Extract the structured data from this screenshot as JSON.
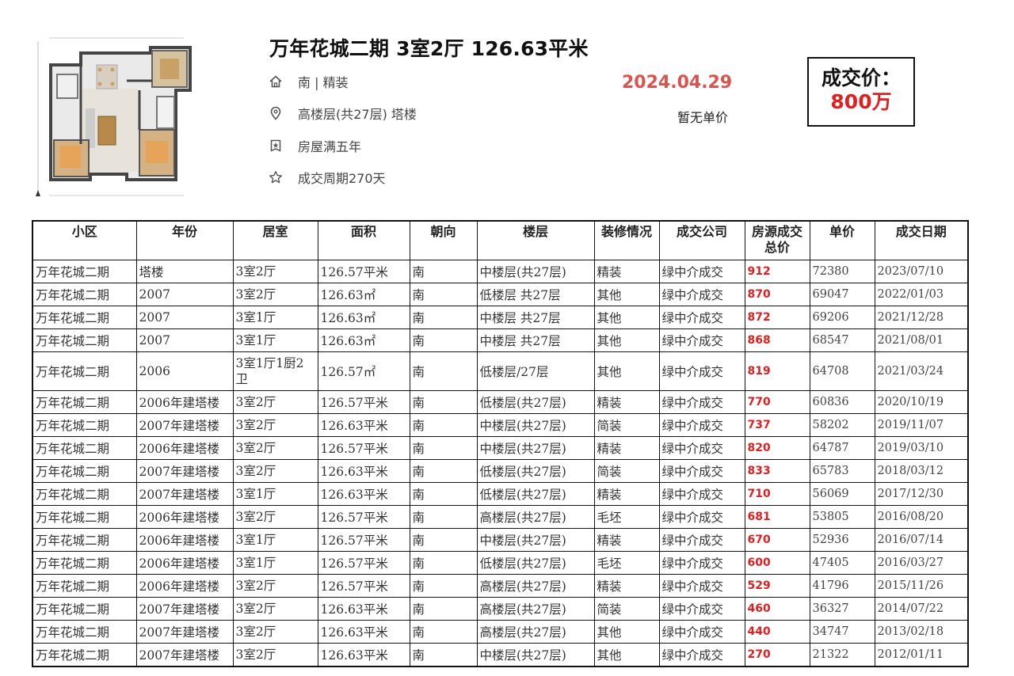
{
  "listing": {
    "title": "万年花城二期 3室2厅 126.63平米",
    "features": [
      {
        "icon": "home-icon",
        "text": "南 | 精装"
      },
      {
        "icon": "location-pin-icon",
        "text": "高楼层(共27层) 塔楼"
      },
      {
        "icon": "badge-icon",
        "text": "房屋满五年"
      },
      {
        "icon": "star-icon",
        "text": "成交周期270天"
      }
    ],
    "deal_date": "2024.04.29",
    "unit_price_note": "暂无单价",
    "deal_price_label": "成交价：",
    "deal_price_value": "800万"
  },
  "colors": {
    "accent_red": "#e02020",
    "date_red": "#d9534f"
  },
  "table": {
    "headers": [
      "小区",
      "年份",
      "居室",
      "面积",
      "朝向",
      "楼层",
      "装修情况",
      "成交公司",
      "房源成交总价",
      "单价",
      "成交日期"
    ],
    "rows": [
      [
        "万年花城二期",
        "塔楼",
        "3室2厅",
        "126.57平米",
        "南",
        "中楼层(共27层)",
        "精装",
        "绿中介成交",
        "912",
        "72380",
        "2023/07/10"
      ],
      [
        "万年花城二期",
        "2007",
        "3室2厅",
        "126.63㎡",
        "南",
        "低楼层 共27层",
        "其他",
        "绿中介成交",
        "870",
        "69047",
        "2022/01/03"
      ],
      [
        "万年花城二期",
        "2007",
        "3室1厅",
        "126.63㎡",
        "南",
        "中楼层 共27层",
        "其他",
        "绿中介成交",
        "872",
        "69206",
        "2021/12/28"
      ],
      [
        "万年花城二期",
        "2007",
        "3室1厅",
        "126.63㎡",
        "南",
        "中楼层 共27层",
        "其他",
        "绿中介成交",
        "868",
        "68547",
        "2021/08/01"
      ],
      [
        "万年花城二期",
        "2006",
        "3室1厅1厨2卫",
        "126.57㎡",
        "南",
        "低楼层/27层",
        "其他",
        "绿中介成交",
        "819",
        "64708",
        "2021/03/24"
      ],
      [
        "万年花城二期",
        "2006年建塔楼",
        "3室2厅",
        "126.57平米",
        "南",
        "低楼层(共27层)",
        "精装",
        "绿中介成交",
        "770",
        "60836",
        "2020/10/19"
      ],
      [
        "万年花城二期",
        "2007年建塔楼",
        "3室2厅",
        "126.63平米",
        "南",
        "中楼层(共27层)",
        "简装",
        "绿中介成交",
        "737",
        "58202",
        "2019/11/07"
      ],
      [
        "万年花城二期",
        "2006年建塔楼",
        "3室2厅",
        "126.57平米",
        "南",
        "中楼层(共27层)",
        "精装",
        "绿中介成交",
        "820",
        "64787",
        "2019/03/10"
      ],
      [
        "万年花城二期",
        "2007年建塔楼",
        "3室2厅",
        "126.63平米",
        "南",
        "低楼层(共27层)",
        "简装",
        "绿中介成交",
        "833",
        "65783",
        "2018/03/12"
      ],
      [
        "万年花城二期",
        "2007年建塔楼",
        "3室1厅",
        "126.63平米",
        "南",
        "低楼层(共27层)",
        "精装",
        "绿中介成交",
        "710",
        "56069",
        "2017/12/30"
      ],
      [
        "万年花城二期",
        "2006年建塔楼",
        "3室2厅",
        "126.57平米",
        "南",
        "高楼层(共27层)",
        "毛坯",
        "绿中介成交",
        "681",
        "53805",
        "2016/08/20"
      ],
      [
        "万年花城二期",
        "2006年建塔楼",
        "3室1厅",
        "126.57平米",
        "南",
        "中楼层(共27层)",
        "精装",
        "绿中介成交",
        "670",
        "52936",
        "2016/07/14"
      ],
      [
        "万年花城二期",
        "2006年建塔楼",
        "3室1厅",
        "126.57平米",
        "南",
        "低楼层(共27层)",
        "毛坯",
        "绿中介成交",
        "600",
        "47405",
        "2016/03/27"
      ],
      [
        "万年花城二期",
        "2006年建塔楼",
        "3室2厅",
        "126.57平米",
        "南",
        "高楼层(共27层)",
        "精装",
        "绿中介成交",
        "529",
        "41796",
        "2015/11/26"
      ],
      [
        "万年花城二期",
        "2007年建塔楼",
        "3室2厅",
        "126.63平米",
        "南",
        "高楼层(共27层)",
        "简装",
        "绿中介成交",
        "460",
        "36327",
        "2014/07/22"
      ],
      [
        "万年花城二期",
        "2007年建塔楼",
        "3室2厅",
        "126.63平米",
        "南",
        "高楼层(共27层)",
        "其他",
        "绿中介成交",
        "440",
        "34747",
        "2013/02/18"
      ],
      [
        "万年花城二期",
        "2007年建塔楼",
        "3室2厅",
        "126.63平米",
        "南",
        "中楼层(共27层)",
        "其他",
        "绿中介成交",
        "270",
        "21322",
        "2012/01/11"
      ]
    ]
  }
}
